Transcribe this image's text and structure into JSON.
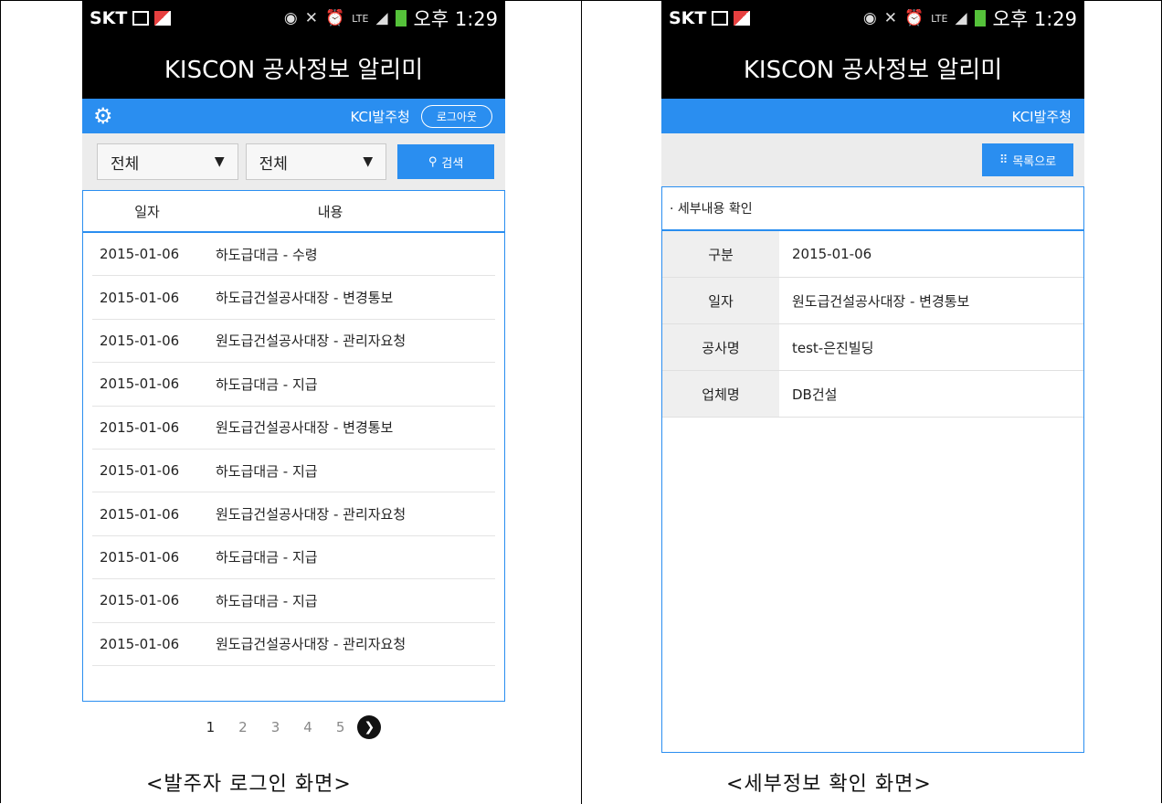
{
  "status": {
    "carrier": "SKT",
    "network": "LTE",
    "time": "오후 1:29"
  },
  "left_screen": {
    "title": "KISCON 공사정보 알리미",
    "agency": "KCI발주청",
    "logout": "로그아웃",
    "filter1": "전체",
    "filter2": "전체",
    "search": "검색",
    "headers": [
      "일자",
      "내용"
    ],
    "rows": [
      {
        "date": "2015-01-06",
        "content": "하도급대금 - 수령"
      },
      {
        "date": "2015-01-06",
        "content": "하도급건설공사대장 - 변경통보"
      },
      {
        "date": "2015-01-06",
        "content": "원도급건설공사대장 - 관리자요청"
      },
      {
        "date": "2015-01-06",
        "content": "하도급대금 - 지급"
      },
      {
        "date": "2015-01-06",
        "content": "원도급건설공사대장 - 변경통보"
      },
      {
        "date": "2015-01-06",
        "content": "하도급대금 - 지급"
      },
      {
        "date": "2015-01-06",
        "content": "원도급건설공사대장 - 관리자요청"
      },
      {
        "date": "2015-01-06",
        "content": "하도급대금 - 지급"
      },
      {
        "date": "2015-01-06",
        "content": "하도급대금 - 지급"
      },
      {
        "date": "2015-01-06",
        "content": "원도급건설공사대장 - 관리자요청"
      }
    ],
    "pages": [
      "1",
      "2",
      "3",
      "4",
      "5"
    ],
    "current_page": "1",
    "caption": "<발주자 로그인 화면>"
  },
  "right_screen": {
    "title": "KISCON 공사정보 알리미",
    "agency": "KCI발주청",
    "list_button": "목록으로",
    "section_title": "· 세부내용 확인",
    "fields": [
      {
        "label": "구분",
        "value": "2015-01-06"
      },
      {
        "label": "일자",
        "value": "원도급건설공사대장 - 변경통보"
      },
      {
        "label": "공사명",
        "value": "test-은진빌딩"
      },
      {
        "label": "업체명",
        "value": "DB건설"
      }
    ],
    "caption": "<세부정보 확인 화면>"
  },
  "colors": {
    "accent": "#2a8ef0",
    "bar_bg": "#000000"
  }
}
